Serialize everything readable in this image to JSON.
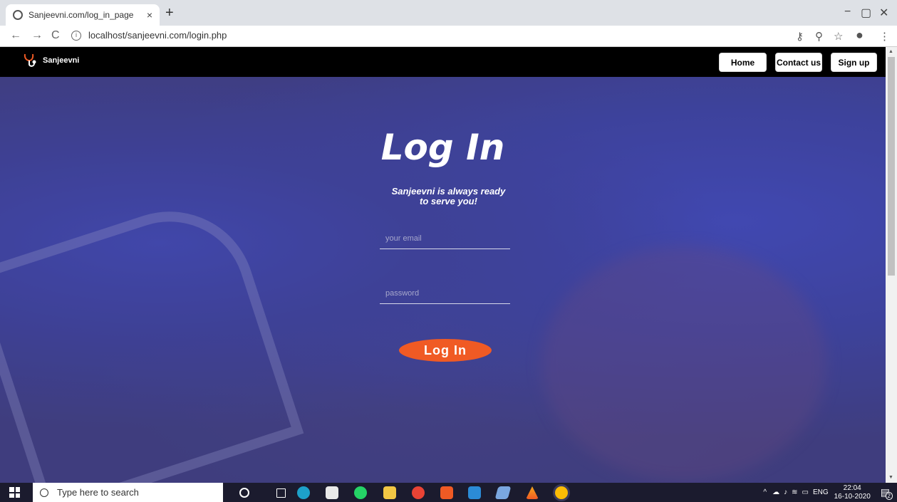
{
  "browser": {
    "tab_title": "Sanjeevni.com/log_in_page",
    "tab_close": "×",
    "new_tab": "+",
    "url": "localhost/sanjeevni.com/login.php",
    "window_controls": [
      "−",
      "▢",
      "✕"
    ],
    "nav": [
      "←",
      "→",
      "C"
    ]
  },
  "navbar": {
    "brand": "Sanjeevni",
    "links": [
      "Home",
      "Contact us",
      "Sign up"
    ]
  },
  "login": {
    "heading": "Log In",
    "tagline_line1": "Sanjeevni is always ready",
    "tagline_line2": "to serve you!",
    "email_placeholder": "your email",
    "password_placeholder": "password",
    "button": "Log In"
  },
  "taskbar": {
    "search_placeholder": "Type here to search",
    "tray_lang": "ENG",
    "time": "22:04",
    "date": "16-10-2020",
    "notification_count": "2"
  },
  "colors": {
    "accent_button": "#f05a24",
    "navbar_bg": "#000000",
    "overlay": "#3e3f78"
  }
}
